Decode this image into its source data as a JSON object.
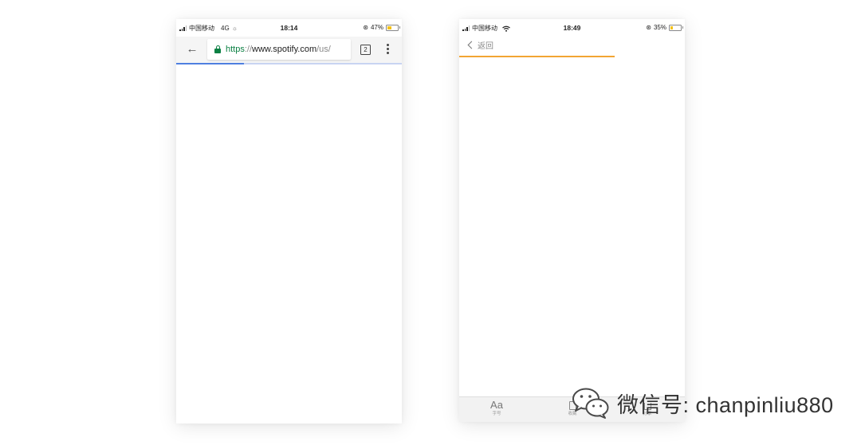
{
  "left_phone": {
    "status": {
      "carrier": "中国移动",
      "network": "4G",
      "time": "18:14",
      "battery": "47%",
      "battery_level": 0.47
    },
    "browser": {
      "url_scheme": "https",
      "url_separator": "://",
      "url_host": "www.spotify.com",
      "url_path": "/us/",
      "tab_count": "2",
      "load_progress": 0.3
    }
  },
  "right_phone": {
    "status": {
      "carrier": "中国移动",
      "time": "18:49",
      "battery": "35%",
      "battery_level": 0.35
    },
    "nav": {
      "back_label": "返回"
    },
    "load_progress": 0.69,
    "toolbar": {
      "font_glyph": "Aa",
      "font_label": "字号",
      "favorite_label": "收藏",
      "share_label": "分享"
    }
  },
  "watermark": {
    "text": "微信号: chanpinliu880"
  },
  "colors": {
    "secure_green": "#0b8043",
    "chrome_progress": "#4f7fe0",
    "wechat_progress": "#f2a533",
    "battery_fill": "#f5c21b"
  }
}
